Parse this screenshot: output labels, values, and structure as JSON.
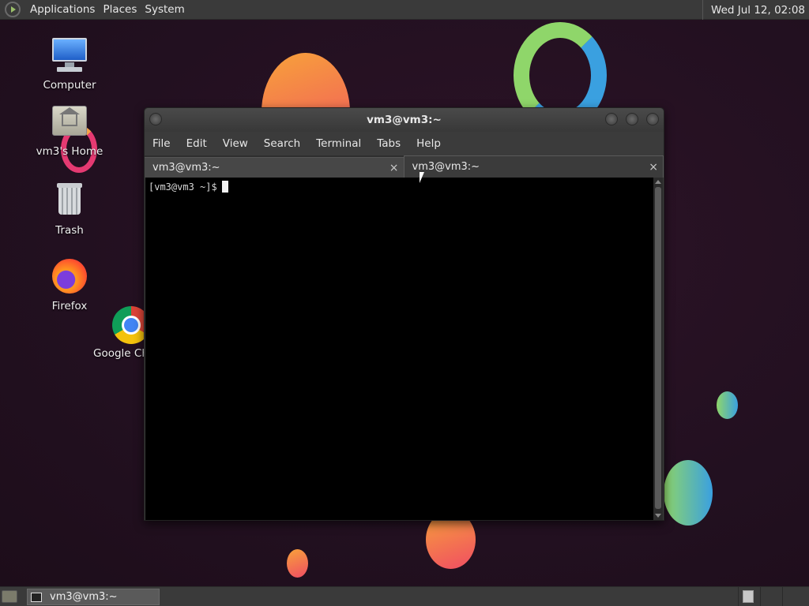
{
  "top_panel": {
    "menus": [
      "Applications",
      "Places",
      "System"
    ],
    "clock": "Wed Jul 12, 02:08"
  },
  "desktop_icons": [
    {
      "label": "Computer",
      "icon": "computer-icon"
    },
    {
      "label": "vm3's Home",
      "icon": "home-folder-icon"
    },
    {
      "label": "Trash",
      "icon": "trash-icon"
    },
    {
      "label": "Firefox",
      "icon": "firefox-icon"
    },
    {
      "label": "Google Ch",
      "icon": "chrome-icon"
    }
  ],
  "window": {
    "title": "vm3@vm3:~",
    "menu": [
      "File",
      "Edit",
      "View",
      "Search",
      "Terminal",
      "Tabs",
      "Help"
    ],
    "tabs": [
      {
        "label": "vm3@vm3:~",
        "active": false
      },
      {
        "label": "vm3@vm3:~",
        "active": true
      }
    ],
    "close_glyph": "×",
    "prompt": "[vm3@vm3 ~]$"
  },
  "taskbar": {
    "task_label": "vm3@vm3:~"
  },
  "colors": {
    "panel": "#3a3a3a",
    "desktop": "#25111f",
    "terminal_bg": "#000000"
  }
}
